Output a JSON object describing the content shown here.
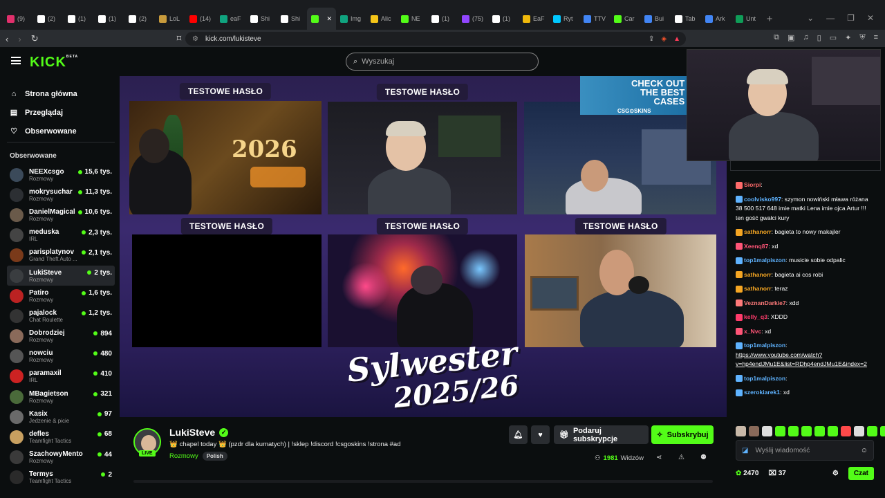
{
  "browser": {
    "tabs": [
      {
        "label": "(9)",
        "color": "#e1306c"
      },
      {
        "label": "(2)",
        "color": "#ffffff"
      },
      {
        "label": "(1)",
        "color": "#ffffff"
      },
      {
        "label": "(1)",
        "color": "#ffffff"
      },
      {
        "label": "(2)",
        "color": "#ffffff"
      },
      {
        "label": "LoL",
        "color": "#c89b3c"
      },
      {
        "label": "(14)",
        "color": "#ff0000"
      },
      {
        "label": "eaF",
        "color": "#10a37f"
      },
      {
        "label": "Shi",
        "color": "#ffffff"
      },
      {
        "label": "Shi",
        "color": "#ffffff"
      },
      {
        "label": "",
        "color": "#53fc18",
        "active": true
      },
      {
        "label": "Img",
        "color": "#10a37f"
      },
      {
        "label": "Alic",
        "color": "#f5c518"
      },
      {
        "label": "NE",
        "color": "#53fc18"
      },
      {
        "label": "(1)",
        "color": "#ffffff"
      },
      {
        "label": "(75)",
        "color": "#9146ff"
      },
      {
        "label": "(1)",
        "color": "#ffffff"
      },
      {
        "label": "EaF",
        "color": "#f0b90b"
      },
      {
        "label": "Ryt",
        "color": "#00c8ff"
      },
      {
        "label": "TTV",
        "color": "#4285f4"
      },
      {
        "label": "Car",
        "color": "#53fc18"
      },
      {
        "label": "Bui",
        "color": "#4285f4"
      },
      {
        "label": "Tab",
        "color": "#ffffff"
      },
      {
        "label": "Ark",
        "color": "#4285f4"
      },
      {
        "label": "Unt",
        "color": "#0f9d58"
      }
    ],
    "url": "kick.com/lukisteve"
  },
  "header": {
    "logo": "KICK",
    "logo_sup": "BETA",
    "search_placeholder": "Wyszukaj"
  },
  "sidebar": {
    "nav": [
      {
        "label": "Strona główna",
        "icon": "home-icon"
      },
      {
        "label": "Przeglądaj",
        "icon": "browse-icon"
      },
      {
        "label": "Obserwowane",
        "icon": "heart-icon"
      }
    ],
    "followed_title": "Obserwowane",
    "channels": [
      {
        "name": "NEEXcsgo",
        "category": "Rozmowy",
        "viewers": "15,6 tys.",
        "color": "#3b4a5a"
      },
      {
        "name": "mokrysuchar",
        "category": "Rozmowy",
        "viewers": "11,3 tys.",
        "color": "#2c2f33"
      },
      {
        "name": "DanielMagical",
        "category": "Rozmowy",
        "viewers": "10,6 tys.",
        "color": "#6a5a4a"
      },
      {
        "name": "meduska",
        "category": "IRL",
        "viewers": "2,3 tys.",
        "color": "#444"
      },
      {
        "name": "parisplatynov",
        "category": "Grand Theft Auto ...",
        "viewers": "2,1 tys.",
        "color": "#7a3a1a"
      },
      {
        "name": "LukiSteve",
        "category": "Rozmowy",
        "viewers": "2 tys.",
        "color": "#3a3d40",
        "active": true
      },
      {
        "name": "Patiro",
        "category": "Rozmowy",
        "viewers": "1,6 tys.",
        "color": "#b22"
      },
      {
        "name": "pajalock",
        "category": "Chat Roulette",
        "viewers": "1,2 tys.",
        "color": "#333"
      },
      {
        "name": "Dobrodziej",
        "category": "Rozmowy",
        "viewers": "894",
        "color": "#8a6a5a"
      },
      {
        "name": "nowciu",
        "category": "Rozmowy",
        "viewers": "480",
        "color": "#555"
      },
      {
        "name": "paramaxil",
        "category": "IRL",
        "viewers": "410",
        "color": "#c22"
      },
      {
        "name": "MBagietson",
        "category": "Rozmowy",
        "viewers": "321",
        "color": "#4a6a3a"
      },
      {
        "name": "Kasix",
        "category": "Jedzenie & picie",
        "viewers": "97",
        "color": "#6a6a6a"
      },
      {
        "name": "defles",
        "category": "Teamfight Tactics",
        "viewers": "68",
        "color": "#c8a060"
      },
      {
        "name": "SzachowyMentor1...",
        "category": "Rozmowy",
        "viewers": "44",
        "color": "#3a3a3a"
      },
      {
        "name": "Termys",
        "category": "Teamfight Tactics",
        "viewers": "2",
        "color": "#2a2a2a"
      }
    ]
  },
  "video": {
    "slot_label": "TESTOWE HASŁO",
    "sylwester_line1": "Sylwester",
    "sylwester_line2": "2025/26",
    "ad_text_line1": "CHECK OUT",
    "ad_text_line2": "THE BEST",
    "ad_text_line3": "CASES",
    "ad_brand": "CSG⊙SKINS",
    "year_sign": "2026"
  },
  "stream": {
    "name": "LukiSteve",
    "live": "LIVE",
    "title": "👑 chapel today 👑 (pzdr dla kumatych) | !sklep !discord !csgoskins !strona #ad",
    "category": "Rozmowy",
    "language": "Polish",
    "gift_sub_label": "Podaruj subskrypcje",
    "subscribe_label": "Subskrybuj",
    "viewers_count": "1981",
    "viewers_label": "Widzów"
  },
  "chat": {
    "messages": [
      {
        "user": "Siorpi",
        "text": "",
        "color": "#ff6b6b"
      },
      {
        "user": "coolvisko997",
        "text": "szymon nowiński mława różana 38 500 517 648 imie matki Lena imie ojca Artur !!! ten gość gwałci kury",
        "color": "#5fb3ff"
      },
      {
        "user": "sathanorr",
        "text": "bagieta to nowy makajler",
        "color": "#f5a623"
      },
      {
        "user": "Xeenq87",
        "text": "xd",
        "color": "#ff5577"
      },
      {
        "user": "top1malpiszon",
        "text": "musicie sobie odpalic",
        "color": "#5fb3ff"
      },
      {
        "user": "sathanorr",
        "text": "bagieta ai cos robi",
        "color": "#f5a623"
      },
      {
        "user": "sathanorr",
        "text": "teraz",
        "color": "#f5a623"
      },
      {
        "user": "VeznanDarkie7",
        "text": "xdd",
        "color": "#ff7a7a"
      },
      {
        "user": "kelly_q3",
        "text": "XDDD",
        "color": "#ff3b6b"
      },
      {
        "user": "x_Nvc",
        "text": "xd",
        "color": "#ff5577"
      },
      {
        "user": "top1malpiszon",
        "text": "",
        "color": "#5fb3ff",
        "link": "https://www.youtube.com/watch?v=hp4endJMu1E&list=RDhp4endJMu1E&index=2"
      },
      {
        "user": "top1malpiszon",
        "text": "",
        "color": "#5fb3ff"
      },
      {
        "user": "szerokiarek1",
        "text": "xd",
        "color": "#5fb3ff"
      }
    ],
    "input_placeholder": "Wyślij wiadomość",
    "points": "2470",
    "gift_count": "37",
    "chat_button": "Czat"
  }
}
